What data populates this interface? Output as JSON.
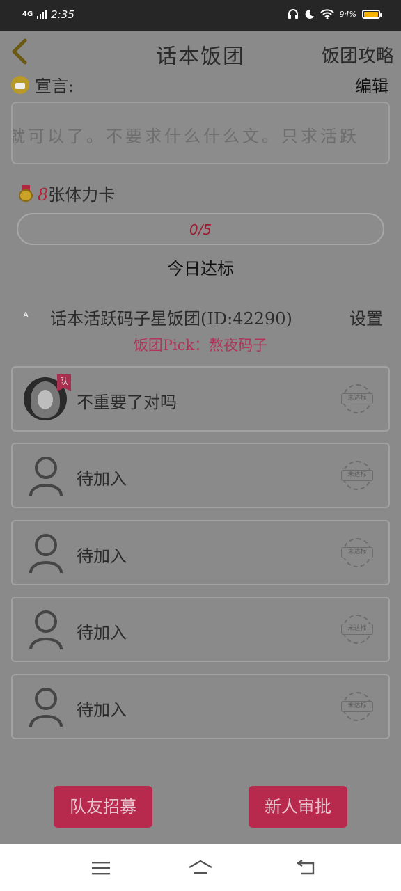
{
  "status_bar": {
    "network": "4G",
    "time": "2:35",
    "battery": "94%"
  },
  "header": {
    "back_icon": "chevron-left-icon",
    "title": "话本饭团",
    "strategy": "饭团攻略"
  },
  "declaration": {
    "label": "宣言:",
    "edit": "编辑",
    "text": "就可以了。不要求什么什么文。只求活跃"
  },
  "stamina": {
    "count": "8",
    "suffix": "张体力卡"
  },
  "progress": {
    "text": "0/5",
    "current": 0,
    "total": 5,
    "label": "今日达标"
  },
  "group": {
    "name": "话本活跃码子星饭团(ID:42290)",
    "settings": "设置",
    "pick": "饭团Pick：熬夜码子"
  },
  "members": [
    {
      "name": "不重要了对吗",
      "is_leader": true,
      "badge": "队",
      "status": "未达标"
    },
    {
      "name": "待加入",
      "is_leader": false,
      "status": "未达标"
    },
    {
      "name": "待加入",
      "is_leader": false,
      "status": "未达标"
    },
    {
      "name": "待加入",
      "is_leader": false,
      "status": "未达标"
    },
    {
      "name": "待加入",
      "is_leader": false,
      "status": "未达标"
    }
  ],
  "actions": {
    "recruit": "队友招募",
    "approve": "新人审批"
  },
  "colors": {
    "accent": "#b8294e",
    "status_bar": "#262626",
    "overlay": "#8a8a8a"
  }
}
